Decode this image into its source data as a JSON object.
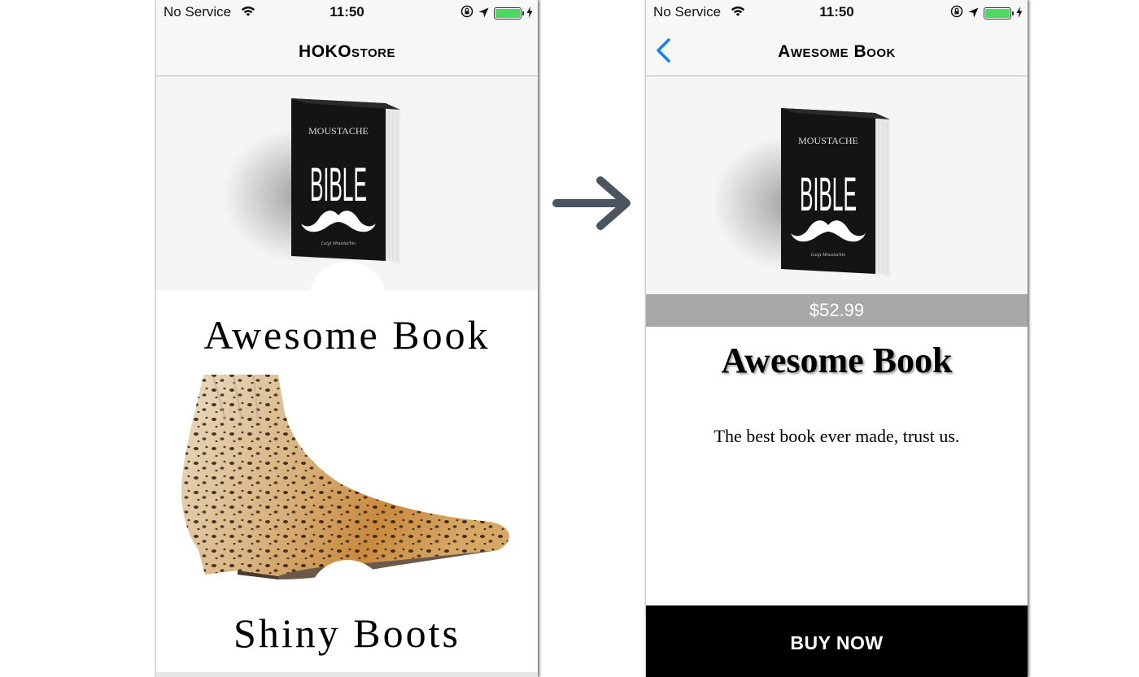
{
  "status_bar": {
    "carrier": "No Service",
    "time": "11:50",
    "battery_level": 1.0
  },
  "list_screen": {
    "nav_title": "HOKOstore",
    "products": [
      {
        "title": "Awesome Book",
        "book_cover": {
          "line1": "MOUSTACHE",
          "line2": "BIBLE",
          "author": "Luigi Moustachio"
        }
      },
      {
        "title": "Shiny Boots"
      }
    ]
  },
  "detail_screen": {
    "nav_title": "Awesome Book",
    "price": "$52.99",
    "title": "Awesome Book",
    "description": "The best book ever made, trust us.",
    "buy_label": "BUY NOW"
  },
  "icons": {
    "wifi": "wifi-icon",
    "orientation_lock": "orientation-lock-icon",
    "location": "location-arrow-icon",
    "battery": "battery-icon",
    "back": "chevron-left-icon",
    "transition": "arrow-right-icon"
  },
  "colors": {
    "accent": "#147efb",
    "battery": "#4cd964",
    "price_bar": "#a8a8a8",
    "buy_button": "#000000",
    "arrow": "#4a5560"
  }
}
